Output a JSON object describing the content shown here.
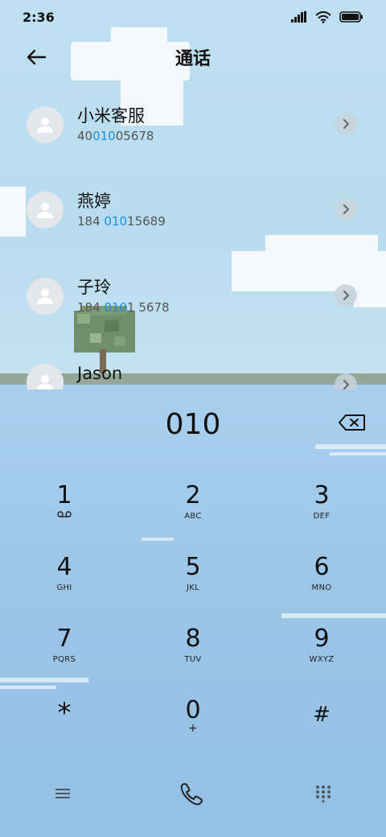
{
  "status_bar": {
    "time": "2:36",
    "icons": [
      "signal-icon",
      "wifi-icon",
      "battery-icon"
    ]
  },
  "header": {
    "title": "通话",
    "back_icon": "arrow-left-icon"
  },
  "contacts": [
    {
      "name": "小米客服",
      "number_pre": "40",
      "number_hl": "010",
      "number_post": "05678"
    },
    {
      "name": "燕婷",
      "number_pre": "184 ",
      "number_hl": "010",
      "number_post": "15689"
    },
    {
      "name": "子玲",
      "number_pre": "184 ",
      "number_hl": "010",
      "number_post": "1 5678"
    },
    {
      "name": "Jason",
      "number_pre": "",
      "number_hl": "",
      "number_post": ""
    }
  ],
  "dialer": {
    "input_value": "010",
    "accent_color": "#1a8fe3",
    "keys": [
      {
        "digit": "1",
        "letters": ""
      },
      {
        "digit": "2",
        "letters": "ABC"
      },
      {
        "digit": "3",
        "letters": "DEF"
      },
      {
        "digit": "4",
        "letters": "GHI"
      },
      {
        "digit": "5",
        "letters": "JKL"
      },
      {
        "digit": "6",
        "letters": "MNO"
      },
      {
        "digit": "7",
        "letters": "PQRS"
      },
      {
        "digit": "8",
        "letters": "TUV"
      },
      {
        "digit": "9",
        "letters": "WXYZ"
      },
      {
        "digit": "*",
        "letters": ""
      },
      {
        "digit": "0",
        "letters": "+"
      },
      {
        "digit": "#",
        "letters": ""
      }
    ]
  },
  "bottom_bar": {
    "icons": [
      "menu-icon",
      "phone-call-icon",
      "keypad-icon"
    ]
  }
}
